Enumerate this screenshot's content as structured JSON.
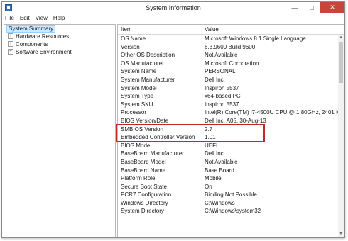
{
  "window": {
    "title": "System Information",
    "buttons": {
      "minimize": "—",
      "maximize": "□",
      "close": "✕"
    }
  },
  "menu": [
    "File",
    "Edit",
    "View",
    "Help"
  ],
  "tree": {
    "root": "System Summary",
    "children": [
      "Hardware Resources",
      "Components",
      "Software Environment"
    ]
  },
  "table": {
    "headers": {
      "item": "Item",
      "value": "Value"
    },
    "rows": [
      {
        "item": "OS Name",
        "value": "Microsoft Windows 8.1 Single Language"
      },
      {
        "item": "Version",
        "value": "6.3.9600 Build 9600"
      },
      {
        "item": "Other OS Description",
        "value": "Not Available"
      },
      {
        "item": "OS Manufacturer",
        "value": "Microsoft Corporation"
      },
      {
        "item": "System Name",
        "value": "PERSONAL"
      },
      {
        "item": "System Manufacturer",
        "value": "Dell Inc."
      },
      {
        "item": "System Model",
        "value": "Inspiron 5537"
      },
      {
        "item": "System Type",
        "value": "x64-based PC"
      },
      {
        "item": "System SKU",
        "value": "Inspiron 5537"
      },
      {
        "item": "Processor",
        "value": "Intel(R) Core(TM) i7-4500U CPU @ 1.80GHz, 2401 M"
      },
      {
        "item": "BIOS Version/Date",
        "value": "Dell Inc. A05, 30-Aug-13"
      },
      {
        "item": "SMBIOS Version",
        "value": "2.7"
      },
      {
        "item": "Embedded Controller Version",
        "value": "1.01"
      },
      {
        "item": "BIOS Mode",
        "value": "UEFI"
      },
      {
        "item": "BaseBoard Manufacturer",
        "value": "Dell Inc."
      },
      {
        "item": "BaseBoard Model",
        "value": "Not Available"
      },
      {
        "item": "BaseBoard Name",
        "value": "Base Board"
      },
      {
        "item": "Platform Role",
        "value": "Mobile"
      },
      {
        "item": "Secure Boot State",
        "value": "On"
      },
      {
        "item": "PCR7 Configuration",
        "value": "Binding Not Possible"
      },
      {
        "item": "Windows Directory",
        "value": "C:\\Windows"
      },
      {
        "item": "System Directory",
        "value": "C:\\Windows\\system32"
      }
    ]
  },
  "colors": {
    "highlight_box": "#c1272d",
    "selection": "#cde8ff",
    "close_button": "#c7463a"
  }
}
